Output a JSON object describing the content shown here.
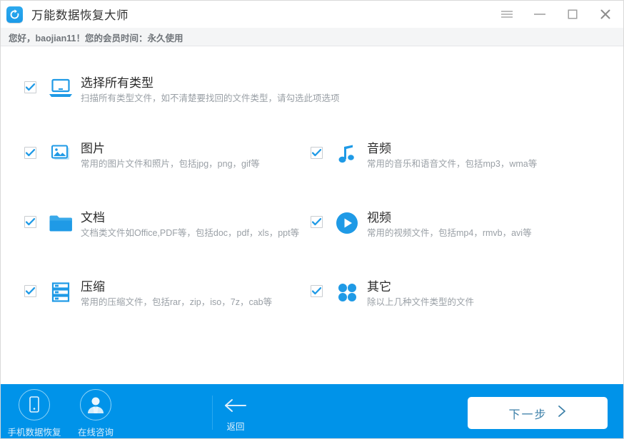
{
  "window": {
    "app_icon": "refresh-circle-icon",
    "title": "万能数据恢复大师",
    "controls": [
      {
        "name": "menu-button",
        "icon": "hamburger-icon"
      },
      {
        "name": "minimize-button",
        "icon": "minimize-icon"
      },
      {
        "name": "maximize-button",
        "icon": "maximize-icon"
      },
      {
        "name": "close-button",
        "icon": "close-icon"
      }
    ],
    "accent_color": "#0093e9",
    "titlebar_bg": "#ffffff",
    "greetbar_bg": "#f4f5f6"
  },
  "greeting": {
    "text": "您好，baojian11！您的会员时间：永久使用"
  },
  "file_types": [
    {
      "id": "all",
      "icon": "laptop-icon",
      "title": "选择所有类型",
      "desc": "扫描所有类型文件，如不清楚要找回的文件类型，请勾选此项选项",
      "checked": true
    },
    {
      "id": "image",
      "icon": "picture-stack-icon",
      "title": "图片",
      "desc": "常用的图片文件和照片，包括jpg，png，gif等",
      "checked": true
    },
    {
      "id": "audio",
      "icon": "music-note-icon",
      "title": "音频",
      "desc": "常用的音乐和语音文件，包括mp3，wma等",
      "checked": true
    },
    {
      "id": "doc",
      "icon": "folder-icon",
      "title": "文档",
      "desc": "文档类文件如Office,PDF等，包括doc，pdf，xls，ppt等",
      "checked": true
    },
    {
      "id": "video",
      "icon": "play-circle-icon",
      "title": "视频",
      "desc": "常用的视频文件，包括mp4，rmvb，avi等",
      "checked": true
    },
    {
      "id": "zip",
      "icon": "layer-stack-icon",
      "title": "压缩",
      "desc": "常用的压缩文件，包括rar，zip，iso，7z，cab等",
      "checked": true
    },
    {
      "id": "other",
      "icon": "four-dots-icon",
      "title": "其它",
      "desc": "除以上几种文件类型的文件",
      "checked": true
    }
  ],
  "footer": {
    "tools": [
      {
        "id": "mobile",
        "icon": "phone-icon",
        "label": "手机数据恢复"
      },
      {
        "id": "chat",
        "icon": "person-icon",
        "label": "在线咨询"
      }
    ],
    "back": {
      "icon": "arrow-left-icon",
      "label": "返回"
    },
    "next": {
      "label": "下一步",
      "icon": "chevron-right-icon"
    }
  }
}
